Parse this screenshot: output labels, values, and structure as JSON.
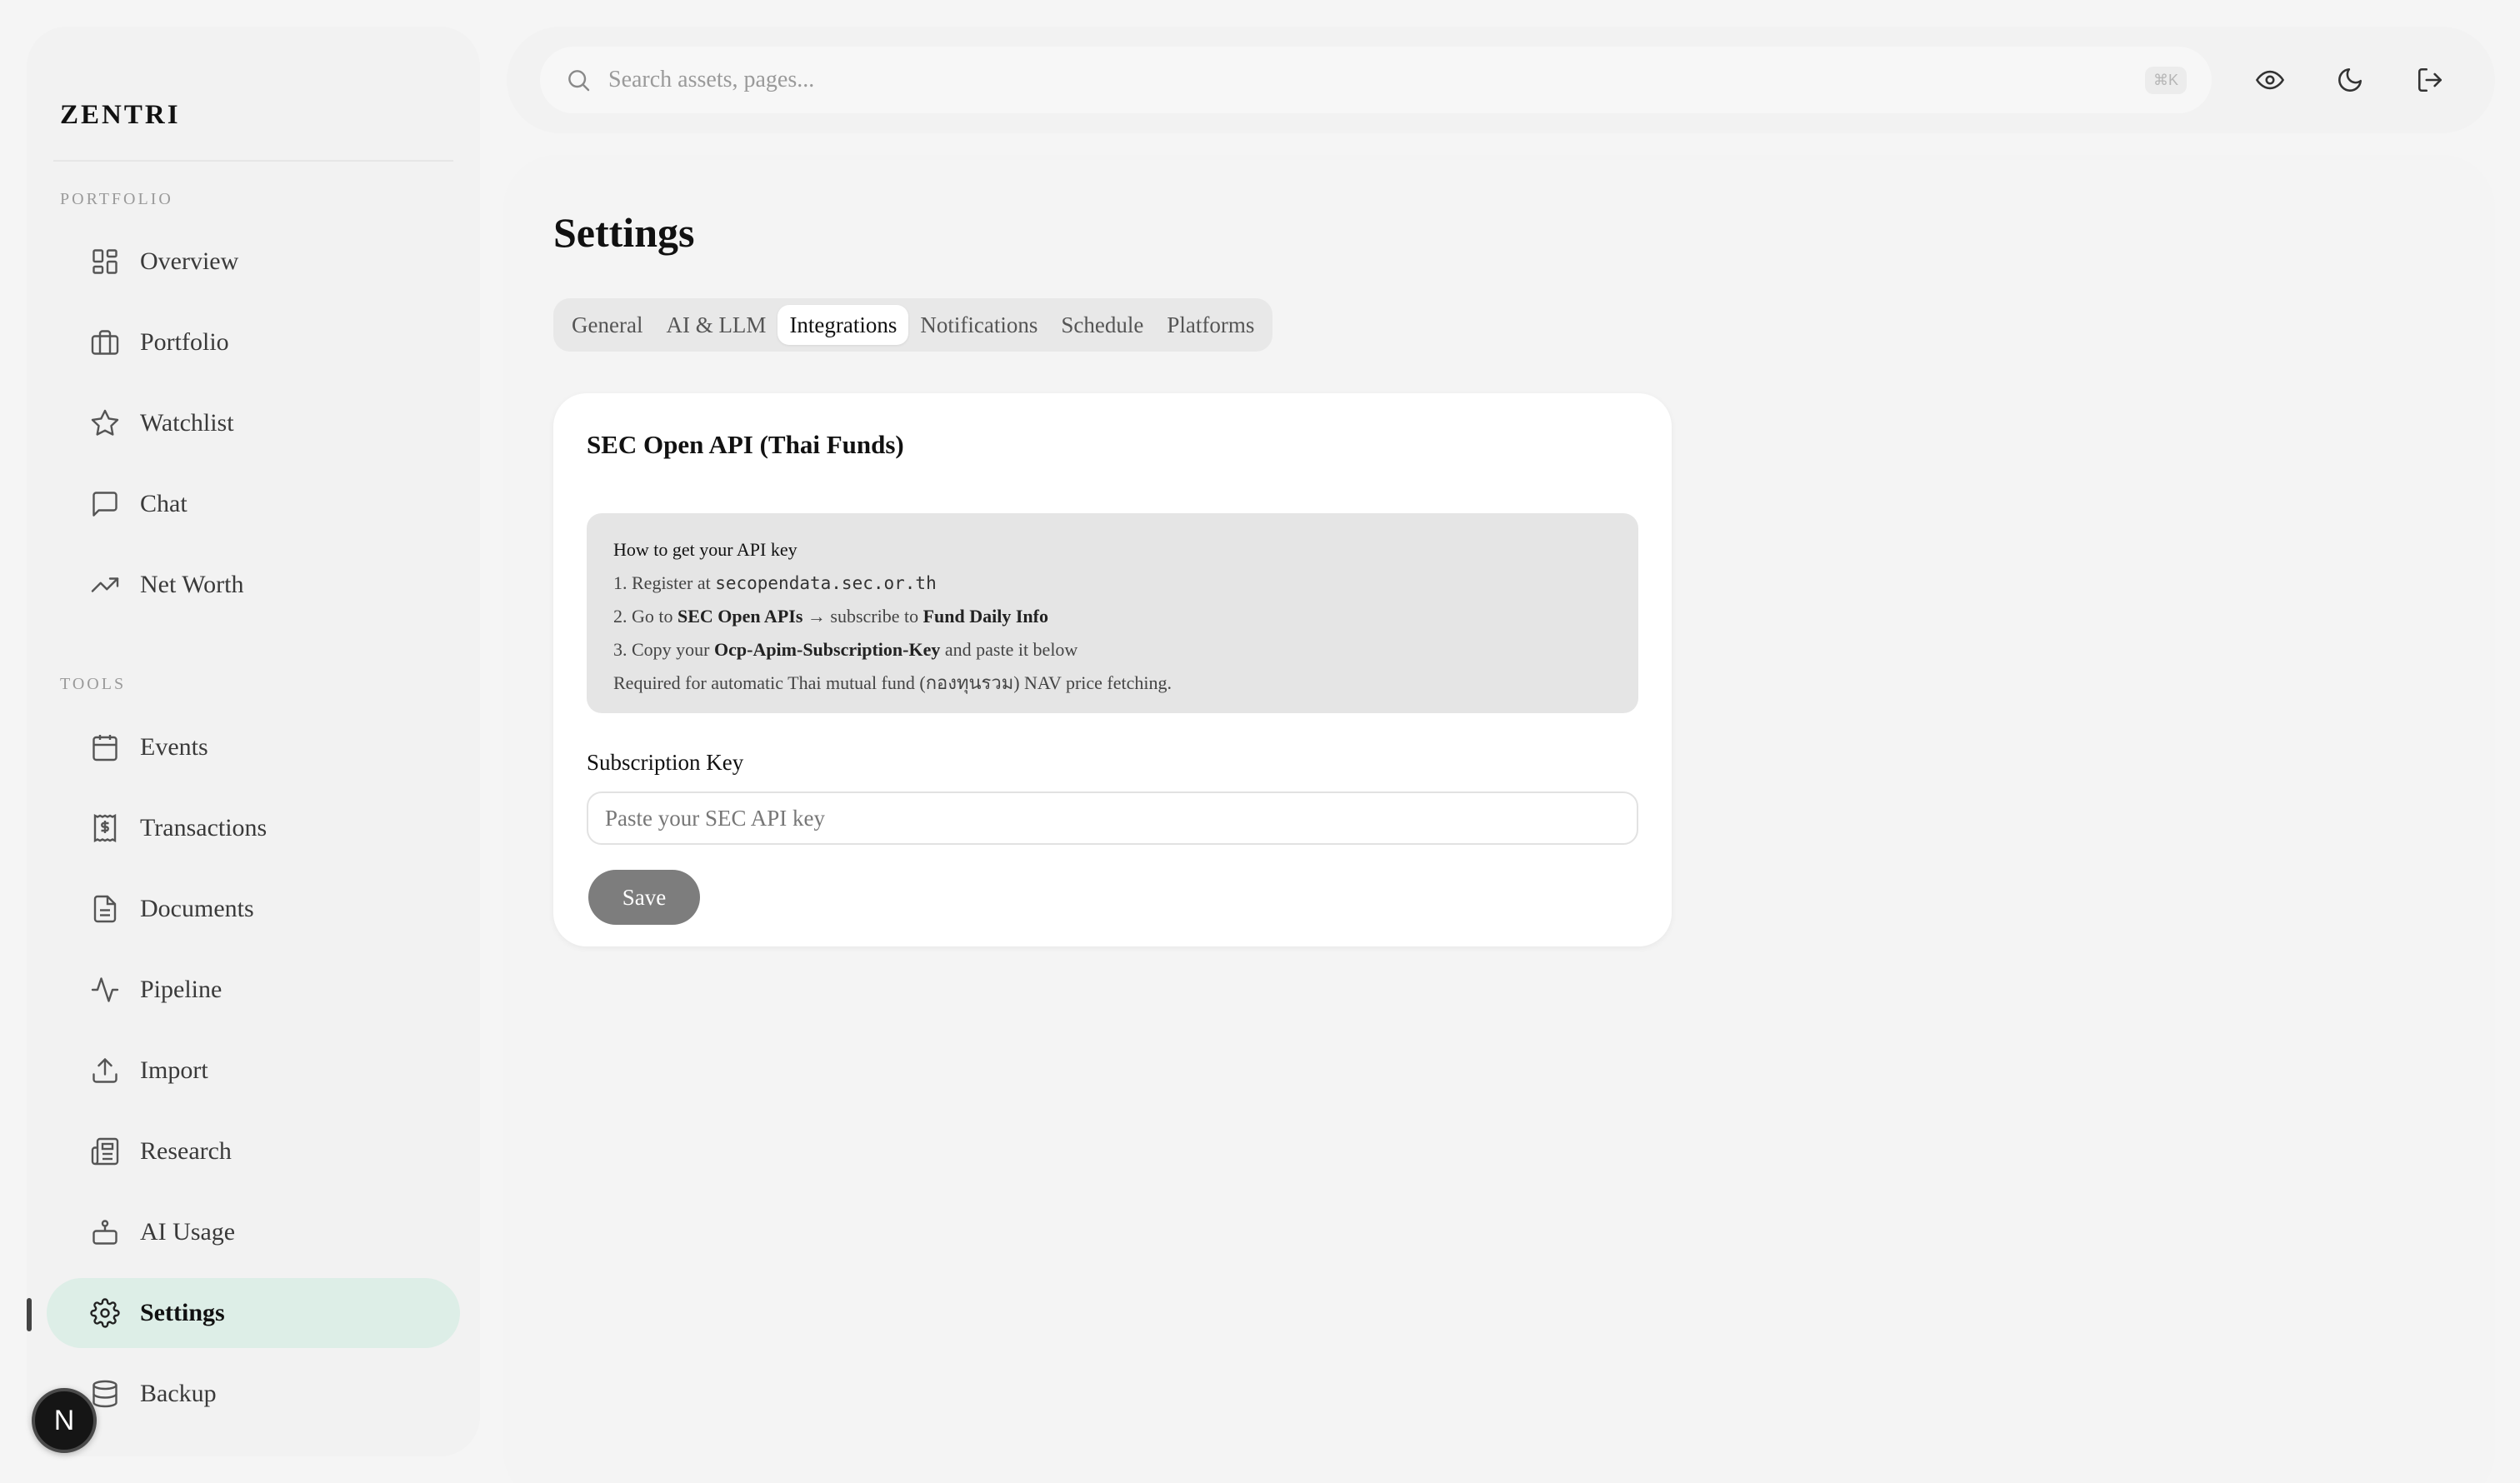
{
  "app": {
    "brand": "ZENTRI"
  },
  "sidebar": {
    "sections": [
      {
        "label": "PORTFOLIO"
      },
      {
        "label": "TOOLS"
      }
    ],
    "portfolio_items": [
      {
        "label": "Overview",
        "icon": "grid-icon"
      },
      {
        "label": "Portfolio",
        "icon": "briefcase-icon"
      },
      {
        "label": "Watchlist",
        "icon": "star-icon"
      },
      {
        "label": "Chat",
        "icon": "chat-icon"
      },
      {
        "label": "Net Worth",
        "icon": "trending-up-icon"
      }
    ],
    "tools_items": [
      {
        "label": "Events",
        "icon": "calendar-icon"
      },
      {
        "label": "Transactions",
        "icon": "receipt-icon"
      },
      {
        "label": "Documents",
        "icon": "document-icon"
      },
      {
        "label": "Pipeline",
        "icon": "activity-icon"
      },
      {
        "label": "Import",
        "icon": "upload-icon"
      },
      {
        "label": "Research",
        "icon": "newspaper-icon"
      },
      {
        "label": "AI Usage",
        "icon": "bot-icon"
      },
      {
        "label": "Settings",
        "icon": "gear-icon",
        "active": true
      },
      {
        "label": "Backup",
        "icon": "database-icon"
      }
    ],
    "avatar_initial": "N",
    "active_color": "#ddeee7"
  },
  "topbar": {
    "search_placeholder": "Search assets, pages...",
    "search_shortcut": "⌘K",
    "actions": [
      "eye-icon",
      "moon-icon",
      "logout-icon"
    ]
  },
  "main": {
    "title": "Settings",
    "tabs": [
      {
        "label": "General"
      },
      {
        "label": "AI & LLM"
      },
      {
        "label": "Integrations",
        "active": true
      },
      {
        "label": "Notifications"
      },
      {
        "label": "Schedule"
      },
      {
        "label": "Platforms"
      }
    ],
    "card": {
      "title": "SEC Open API (Thai Funds)",
      "info": {
        "heading": "How to get your API key",
        "step1_prefix": "1. Register at ",
        "step1_url": "secopendata.sec.or.th",
        "step2_prefix": "2. Go to ",
        "step2_bold1": "SEC Open APIs",
        "step2_mid": " → subscribe to ",
        "step2_bold2": "Fund Daily Info",
        "step3_prefix": "3. Copy your ",
        "step3_bold": "Ocp-Apim-Subscription-Key",
        "step3_suffix": " and paste it below",
        "note": "Required for automatic Thai mutual fund (กองทุนรวม) NAV price fetching."
      },
      "field_label": "Subscription Key",
      "field_placeholder": "Paste your SEC API key",
      "field_value": "",
      "save_label": "Save",
      "save_color": "#7d7d7d"
    }
  }
}
